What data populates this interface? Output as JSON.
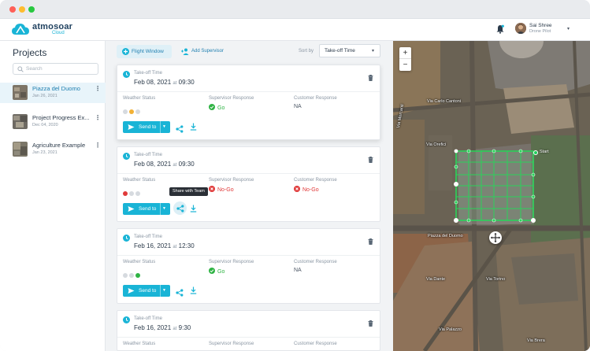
{
  "app": {
    "brand": "atmosoar",
    "brand_sub": "Cloud",
    "user_name": "Sai Shree",
    "user_role": "Drone Pilot"
  },
  "sidebar": {
    "title": "Projects",
    "search_placeholder": "Search",
    "projects": [
      {
        "name": "Piazza del Duomo",
        "date": "Jan 26, 2021",
        "active": true
      },
      {
        "name": "Project Progress Ex...",
        "date": "Dec 04, 2020",
        "active": false
      },
      {
        "name": "Agriculture Example",
        "date": "Jan 23, 2021",
        "active": false
      }
    ]
  },
  "toolbar": {
    "flight_window_label": "Flight Window",
    "add_supervisor_label": "Add Supervisor",
    "sort_by_label": "Sort by",
    "sort_value": "Take-off Time"
  },
  "labels": {
    "takeoff_time": "Take-off Time",
    "at": "at",
    "weather_status": "Weather Status",
    "supervisor_response": "Supervisor Response",
    "customer_response": "Customer Response",
    "send_to": "Send to",
    "share_tooltip": "Share with Team"
  },
  "colors": {
    "accent": "#19b4d6",
    "go": "#2fb344",
    "nogo": "#e03a3a",
    "amber": "#f2b134",
    "dot_off": "#d6dadf"
  },
  "flights": [
    {
      "date": "Feb 08, 2021",
      "time": "09:30",
      "weather": [
        "off",
        "amber",
        "off"
      ],
      "supervisor": "Go",
      "supervisor_status": "go",
      "customer": "NA",
      "customer_status": "na"
    },
    {
      "date": "Feb 08, 2021",
      "time": "09:30",
      "weather": [
        "red",
        "off",
        "off"
      ],
      "supervisor": "No-Go",
      "supervisor_status": "nogo",
      "customer": "No-Go",
      "customer_status": "nogo"
    },
    {
      "date": "Feb 16, 2021",
      "time": "12:30",
      "weather": [
        "off",
        "off",
        "green"
      ],
      "supervisor": "Go",
      "supervisor_status": "go",
      "customer": "NA",
      "customer_status": "na"
    },
    {
      "date": "Feb 16, 2021",
      "time": "9:30",
      "weather": [
        "off",
        "amber",
        "off"
      ],
      "supervisor": "Supervisor Response",
      "supervisor_status": "hidden",
      "customer": "Customer Response",
      "customer_status": "hidden"
    }
  ],
  "map": {
    "labels": [
      "Via Carlo Cantoni",
      "Via Mercanti",
      "Via Orefici",
      "Piazza del Duomo",
      "Via Dante",
      "Via Torino",
      "Via Palazzo",
      "Via Brera"
    ],
    "start_label": "Start"
  }
}
